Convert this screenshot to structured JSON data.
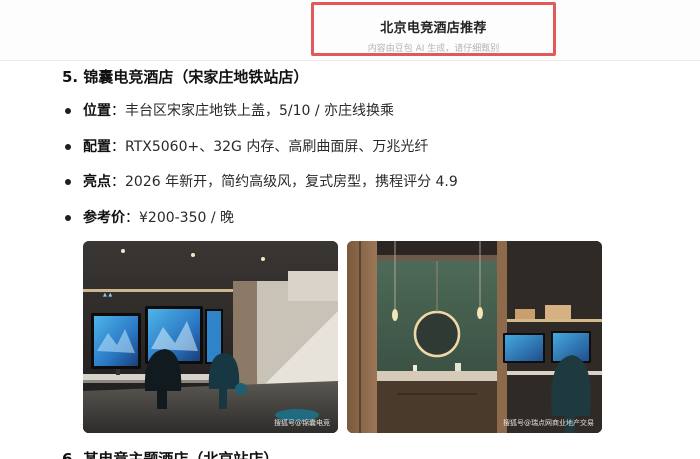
{
  "header": {
    "title": "北京电竞酒店推荐",
    "ai_notice": "内容由豆包 AI 生成，请仔细甄别"
  },
  "section": {
    "heading": "5. 锦囊电竞酒店（宋家庄地铁站店）",
    "separator": "：",
    "bullets": [
      {
        "label": "位置",
        "value": "丰台区宋家庄地铁上盖，5/10 / 亦庄线换乘"
      },
      {
        "label": "配置",
        "value": "RTX5060+、32G 内存、高刷曲面屏、万兆光纤"
      },
      {
        "label": "亮点",
        "value": "2026 年新开，简约高级风，复式房型，携程评分 4.9"
      },
      {
        "label": "参考价",
        "value": "¥200-350 / 晚"
      }
    ]
  },
  "images": [
    {
      "icon": "gaming-room-photo",
      "watermark": "搜狐号@锦囊电竞"
    },
    {
      "icon": "gaming-room-mirror-photo",
      "watermark": "搜狐号@瑞点网商业地产交易"
    }
  ],
  "next_section": {
    "heading_partial": "6. 某电竞主题酒店（北京站店）"
  },
  "colors": {
    "highlight_border": "#e05a5a",
    "notice_text": "#b4b4b4"
  }
}
